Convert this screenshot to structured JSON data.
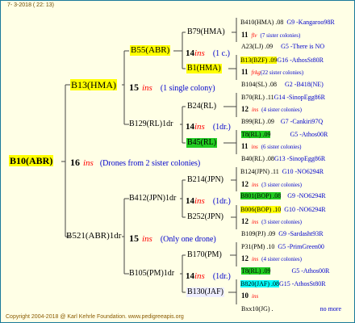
{
  "header": "7- 3-2018 ( 22: 13)",
  "footer": "Copyright 2004-2018 @ Karl Kehrle Foundation.   www.pedigreeapis.org",
  "root": {
    "label": "B10(ABR)",
    "inb": "16",
    "ins": "ins",
    "desc": "(Drones from 2 sister colonies)"
  },
  "gen1": [
    {
      "label": "B13(HMA)",
      "inb": "15",
      "ins": "ins",
      "desc": "(1 single colony)"
    },
    {
      "label": "B521(ABR)1dr",
      "inb": "15",
      "ins": "ins",
      "desc": "(Only one drone)"
    }
  ],
  "gen2": [
    {
      "label": "B55(ABR)",
      "inb": "14",
      "ins": "ins",
      "desc": "(1 c.)"
    },
    {
      "label": "B129(RL)1dr",
      "inb": "14",
      "ins": "ins",
      "desc": "(1dr.)"
    },
    {
      "label": "B412(JPN)1dr",
      "inb": "14",
      "ins": "ins",
      "desc": "(1dr.)"
    },
    {
      "label": "B105(PM)1dr",
      "inb": "14",
      "ins": "ins",
      "desc": "(1dr.)"
    }
  ],
  "gen3": [
    {
      "label": "B79(HMA)"
    },
    {
      "label": "B1(HMA)"
    },
    {
      "label": "B24(RL)"
    },
    {
      "label": "B45(RL)"
    },
    {
      "label": "B214(JPN)"
    },
    {
      "label": "B252(JPN)"
    },
    {
      "label": "B170(PM)"
    },
    {
      "label": "B130(JAF)"
    }
  ],
  "gen4": [
    {
      "top": "B410(HMA) .08",
      "top_b": "G9 -Kangaroo98R",
      "mid": "11",
      "mid_ins": "flv",
      "mid_desc": "(7 sister colonies)",
      "bot": "A23(LJ) .09",
      "bot_b": "G5 -There is NO"
    },
    {
      "top": "B13(BZF) .09",
      "top_b": "G16 -AthosSt80R",
      "mid": "11",
      "mid_ins": "frkg",
      "mid_desc": "(22 sister colonies)",
      "bot": "B104(SL) .08",
      "bot_b": "G2 -B418(NE)"
    },
    {
      "top": "B70(RL) .11",
      "top_b": "G14 -SinopEgg86R",
      "mid": "12",
      "mid_ins": "ins",
      "mid_desc": "(4 sister colonies)",
      "bot": "B99(RL) .09",
      "bot_b": "G7 -Cankiri97Q"
    },
    {
      "top": "T8(RL) .09",
      "top_b": "G5 -Athos00R",
      "mid": "11",
      "mid_ins": "ins",
      "mid_desc": "(6 sister colonies)",
      "bot": "B40(RL) .08",
      "bot_b": "G13 -SinopEgg86R"
    },
    {
      "top": "B124(JPN) .11",
      "top_b": "G10 -NO6294R",
      "mid": "12",
      "mid_ins": "ins",
      "mid_desc": "(3 sister colonies)",
      "bot": "B801(BOP) .08",
      "bot_b": "G9 -NO6294R"
    },
    {
      "top": "B006(BOP) .10",
      "top_b": "G10 -NO6294R",
      "mid": "12",
      "mid_ins": "ins",
      "mid_desc": "(3 sister colonies)",
      "bot": "B109(PJ) .09",
      "bot_b": "G9 -Sardasht93R"
    },
    {
      "top": "P31(PM) .10",
      "top_b": "G5 -PrimGreen00",
      "mid": "12",
      "mid_ins": "ins",
      "mid_desc": "(4 sister colonies)",
      "bot": "T8(RL) .09",
      "bot_b": "G5 -Athos00R"
    },
    {
      "top": "B820(JAF) .08",
      "top_b": "G15 -AthosSt80R",
      "mid": "10",
      "mid_ins": "ins",
      "mid_desc": "",
      "bot": "Bxx10(JG) .",
      "bot_b": "no more"
    }
  ],
  "colors": {
    "border": "#1a7a9a",
    "background": "#ffffe6",
    "highlight_yellow": "#ffff00",
    "highlight_green": "#22cc22",
    "highlight_cyan": "#00ffff",
    "ins_red": "#ff0000",
    "desc_blue": "#0000cc"
  }
}
